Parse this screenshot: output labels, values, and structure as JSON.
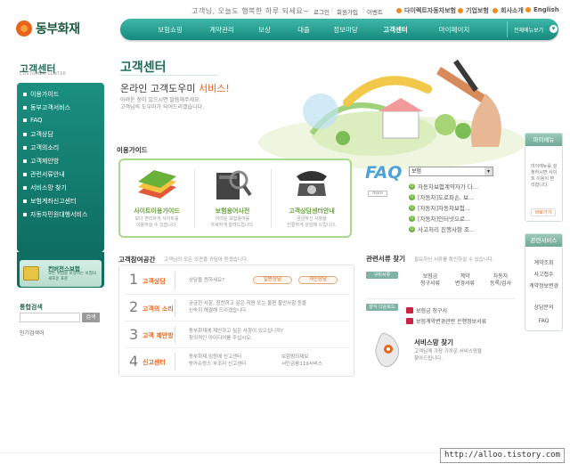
{
  "brand": {
    "name": "동부화재"
  },
  "header": {
    "greeting": "고객님, 오늘도 행복한 하루 되세요~",
    "top_links": [
      "로그인",
      "회원가입",
      "이벤트"
    ],
    "util_links": [
      "다이렉트자동차보험",
      "기업보험",
      "회사소개",
      "English"
    ],
    "gnb": [
      "보험쇼핑",
      "계약관리",
      "보상",
      "대출",
      "정보마당",
      "고객센터",
      "마이페이지"
    ],
    "all_menu": "전체메뉴보기"
  },
  "sidebar": {
    "title": "고객센터",
    "subtitle": "CUSTOMER CENTER",
    "items": [
      "이용가이드",
      "동부고객서비스",
      "FAQ",
      "고객상담",
      "고객의소리",
      "고객제안방",
      "관련서류안내",
      "서비스망 찾기",
      "보험계좌신고센터",
      "자동차민원대행서비스"
    ],
    "banner": {
      "title": "컨버전스보험",
      "desc": "모든 위험을 보장하는 보험의 새로운 표준"
    },
    "search": {
      "title": "통합검색",
      "button": "검색",
      "popular": "인기검색어"
    }
  },
  "main": {
    "title": "고객센터",
    "slogan_pre": "온라인 고객도우미 ",
    "slogan_hl": "서비스!",
    "desc1": "어려운 점이 있으시면 말씀해주세요.",
    "desc2": "고객님의 도우미가 되어드리겠습니다.",
    "guide": {
      "title": "이용가이드",
      "items": [
        {
          "label": "사이트이용가이드",
          "desc1": "보다 편리하게 사이트를",
          "desc2": "이용하실 수 있습니다."
        },
        {
          "label": "보험용어사전",
          "desc1": "어려운 보험용어를",
          "desc2": "자세하게 알려드립니다."
        },
        {
          "label": "고객상담센터안내",
          "desc1": "궁금하신 사항을",
          "desc2": "친절하게 상담해 드립니다."
        }
      ]
    },
    "faq": {
      "logo": "FAQ",
      "more": "more",
      "select_value": "보험",
      "items": [
        "자동차보험계약자가 다...",
        "[자동차]도로파손, 보...",
        "[자동차]자동차보험...",
        "[자동차]인터넷으로...",
        "사고처리 진행사항 조..."
      ]
    },
    "consult": {
      "title": "고객참여공간",
      "subtitle": "고객님의 모든 의견을 귀담아 듣겠습니다.",
      "rows": [
        {
          "num": "1",
          "label": "고객상담",
          "desc1": "상담을 원하세요?",
          "desc2": "",
          "btn1": "일반상담",
          "btn2": "개인상담"
        },
        {
          "num": "2",
          "label": "고객의 소리",
          "desc1": "궁금한 사항, 칭찬하고 싶은 직원 또는 불편 불만사항 등을",
          "desc2": "신속히 해결해 드리겠습니다.",
          "btn1": "",
          "btn2": ""
        },
        {
          "num": "3",
          "label": "고객 제안방",
          "desc1": "동부화재에 제안하고 싶은 사항이 있으십니까?",
          "desc2": "창의적인 아이디어를 주십시오.",
          "btn1": "",
          "btn2": ""
        },
        {
          "num": "4",
          "label": "신고센터",
          "desc1": "동부화재 임원에 신고센터",
          "desc2": "방카슈랑스 부조리 신고센터",
          "btn1": "보험범죄제보",
          "btn2": "서민금융119서비스"
        }
      ]
    },
    "docs": {
      "title": "관련서류 찾기",
      "subtitle": "필요하신 서류를 확인하실 수 있습니다.",
      "tab1": "구비서류",
      "cols": [
        [
          "보험금",
          "청구서류"
        ],
        [
          "계약",
          "변경서류"
        ],
        [
          "자동차",
          "등록/검사"
        ]
      ],
      "tab2": "양식 다운로드",
      "links": [
        "보험금 청구서",
        "보험계약변경관련 은행정보서류"
      ]
    },
    "service": {
      "title": "서비스망 찾기",
      "desc1": "고객님께 가장 가까운 서비스망을",
      "desc2": "찾아드립니다."
    }
  },
  "right": {
    "mypage": {
      "title": "마이메뉴",
      "desc": "마이메뉴를 설정하시면 사이트 이용이 편리합니다.",
      "button": "바로가기"
    },
    "related": {
      "title": "관련서비스",
      "items": [
        "계약조회",
        "사고접수",
        "계약정보변경",
        "상담문의",
        "FAQ"
      ]
    }
  },
  "footer": {
    "watermark": "http://alloo.tistory.com"
  }
}
